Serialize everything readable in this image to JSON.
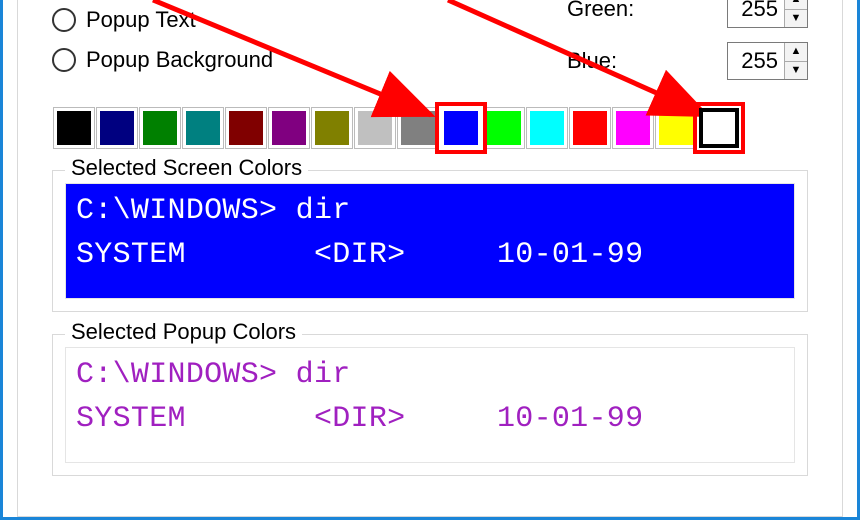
{
  "radios": {
    "popup_text": "Popup Text",
    "popup_background": "Popup Background"
  },
  "rgb": {
    "green_label": "Green:",
    "blue_label": "Blue:",
    "green_value": "255",
    "blue_value": "255"
  },
  "palette": [
    {
      "name": "black",
      "hex": "#000000"
    },
    {
      "name": "navy",
      "hex": "#000080"
    },
    {
      "name": "green",
      "hex": "#008000"
    },
    {
      "name": "teal",
      "hex": "#008080"
    },
    {
      "name": "maroon",
      "hex": "#800000"
    },
    {
      "name": "purple",
      "hex": "#800080"
    },
    {
      "name": "olive",
      "hex": "#808000"
    },
    {
      "name": "silver",
      "hex": "#c0c0c0"
    },
    {
      "name": "gray",
      "hex": "#808080"
    },
    {
      "name": "blue",
      "hex": "#0000ff",
      "selected": "red"
    },
    {
      "name": "lime",
      "hex": "#00ff00"
    },
    {
      "name": "aqua",
      "hex": "#00ffff"
    },
    {
      "name": "red",
      "hex": "#ff0000"
    },
    {
      "name": "fuchsia",
      "hex": "#ff00ff"
    },
    {
      "name": "yellow",
      "hex": "#ffff00"
    },
    {
      "name": "white",
      "hex": "#ffffff",
      "selected": "black"
    }
  ],
  "groups": {
    "screen_legend": "Selected Screen Colors",
    "popup_legend": "Selected Popup Colors"
  },
  "console_sample": {
    "line1": "C:\\WINDOWS> dir",
    "line2": "SYSTEM       <DIR>     10-01-99"
  }
}
